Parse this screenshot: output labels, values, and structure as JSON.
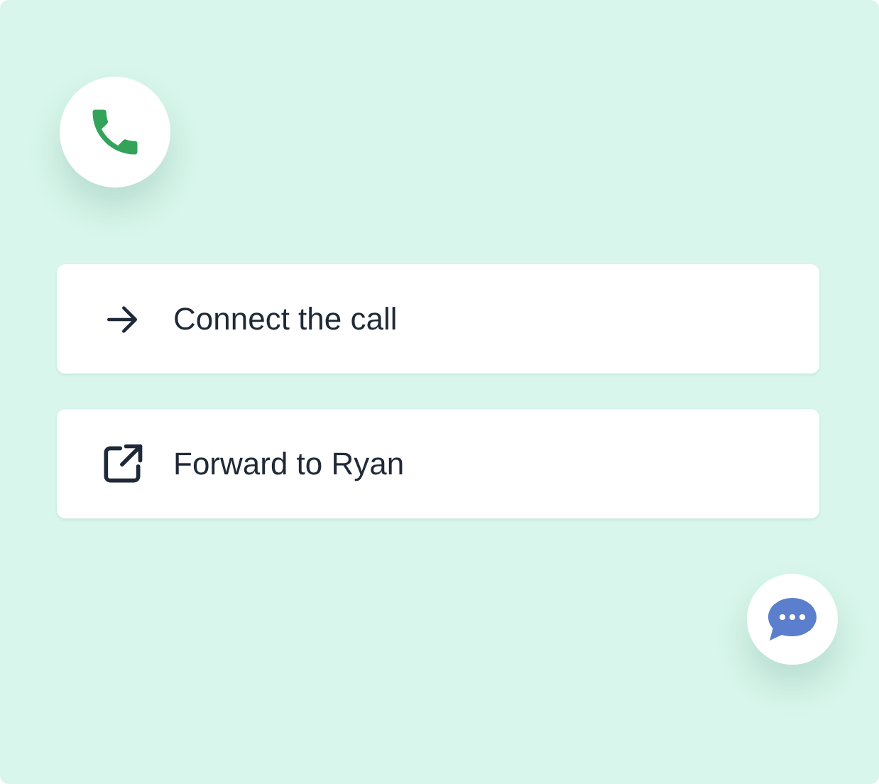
{
  "actions": [
    {
      "kind": "connect",
      "label": "Connect the call"
    },
    {
      "kind": "forward",
      "label": "Forward to Ryan"
    }
  ]
}
